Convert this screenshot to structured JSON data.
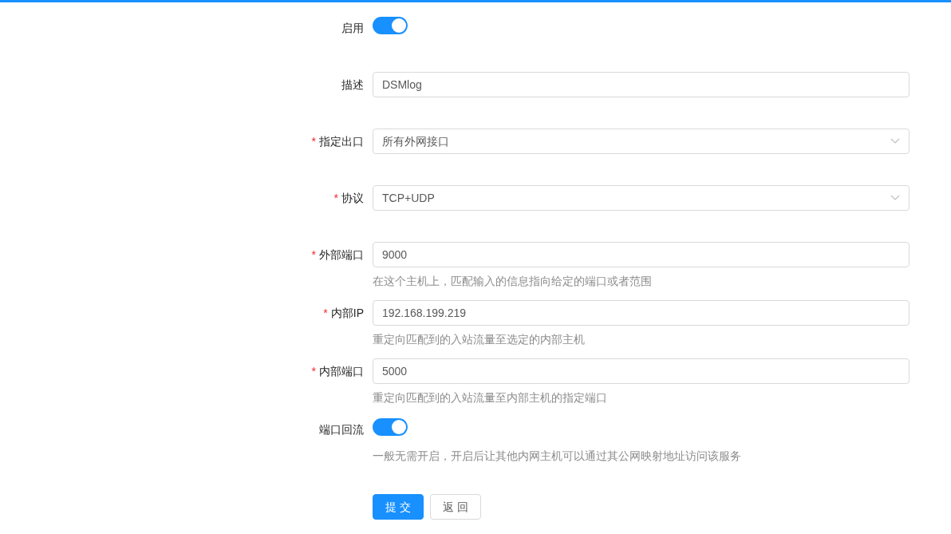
{
  "fields": [
    {
      "kind": "switch",
      "label": "启用",
      "on": true
    },
    {
      "kind": "input",
      "label": "描述",
      "value": "DSMlog"
    },
    {
      "kind": "select",
      "label": "指定出口",
      "required_mark": "*",
      "value": "所有外网接口"
    },
    {
      "kind": "select",
      "label": "协议",
      "required_mark": "*",
      "value": "TCP+UDP"
    },
    {
      "kind": "input",
      "label": "外部端口",
      "required_mark": "*",
      "value": "9000",
      "hint": "在这个主机上，匹配输入的信息指向给定的端口或者范围"
    },
    {
      "kind": "input",
      "label": "内部IP",
      "required_mark": "*",
      "value": "192.168.199.219",
      "hint": "重定向匹配到的入站流量至选定的内部主机"
    },
    {
      "kind": "input",
      "label": "内部端口",
      "required_mark": "*",
      "value": "5000",
      "hint": "重定向匹配到的入站流量至内部主机的指定端口"
    },
    {
      "kind": "switch",
      "label": "端口回流",
      "on": true,
      "hint": "一般无需开启，开启后让其他内网主机可以通过其公网映射地址访问该服务"
    }
  ],
  "buttons": [
    {
      "label": "提 交",
      "kind": "primary"
    },
    {
      "label": "返 回",
      "kind": "default"
    }
  ]
}
